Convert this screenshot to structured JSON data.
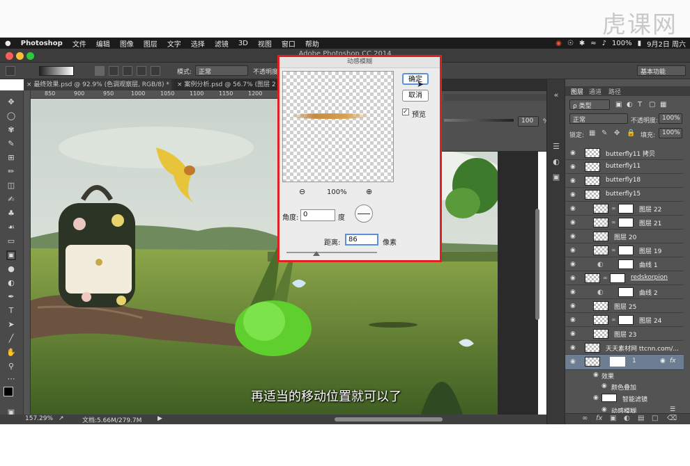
{
  "watermark": "虎课网",
  "menubar": {
    "apple": "",
    "items": [
      "Photoshop",
      "文件",
      "编辑",
      "图像",
      "图层",
      "文字",
      "选择",
      "滤镜",
      "3D",
      "视图",
      "窗口",
      "帮助"
    ],
    "battery": "100%",
    "date": "9月2日 周六"
  },
  "app_title": "Adobe Photoshop CC 2014",
  "options": {
    "mode_label": "模式:",
    "mode_value": "正常",
    "opacity_label": "不透明度",
    "workspace": "基本功能"
  },
  "tabs": [
    {
      "label": "最终效果.psd @ 92.9% (色调观察层, RGB/8) *"
    },
    {
      "label": "案例分析.psd @ 56.7% (图层 2"
    }
  ],
  "ruler_ticks": [
    "850",
    "900",
    "950",
    "1000",
    "1050",
    "1100",
    "1150",
    "1200",
    "1250",
    "1300",
    "1350"
  ],
  "status": {
    "zoom": "157.29%",
    "doc": "文档:5.66M/279.7M"
  },
  "subtitle": "再适当的移动位置就可以了",
  "props": {
    "opacity_value": "100",
    "percent": "%"
  },
  "dialog": {
    "title": "动感模糊",
    "ok": "确定",
    "cancel": "取消",
    "preview_label": "预览",
    "preview_checked": "✓",
    "zoom": "100%",
    "angle_label": "角度:",
    "angle_value": "0",
    "angle_unit": "度",
    "distance_label": "距离:",
    "distance_value": "86",
    "distance_unit": "像素"
  },
  "layers_panel": {
    "tabs": [
      "图层",
      "通道",
      "路径"
    ],
    "kind": "ρ 类型",
    "blend": "正常",
    "opacity_label": "不透明度:",
    "opacity_value": "100%",
    "lock_label": "锁定:",
    "fill_label": "填充:",
    "fill_value": "100%",
    "layers": [
      {
        "name": "butterfly11 拷贝"
      },
      {
        "name": "butterfly11"
      },
      {
        "name": "butterfly18"
      },
      {
        "name": "butterfly15"
      },
      {
        "name": "图层 22"
      },
      {
        "name": "图层 21"
      },
      {
        "name": "图层 20"
      },
      {
        "name": "图层 19"
      },
      {
        "name": "曲线 1"
      },
      {
        "name": "redskorpion"
      },
      {
        "name": "曲线 2"
      },
      {
        "name": "图层 25"
      },
      {
        "name": "图层 24"
      },
      {
        "name": "图层 23"
      },
      {
        "name": "天天素材网 ttcnn.com/..."
      },
      {
        "name": "1"
      }
    ],
    "effects_label": "效果",
    "color_overlay": "颜色叠加",
    "smart_filters": "智能滤镜",
    "motion_blur": "动感模糊"
  }
}
